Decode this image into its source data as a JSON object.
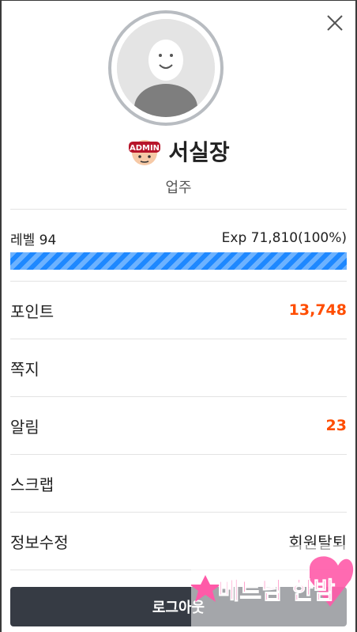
{
  "profile": {
    "nickname": "서실장",
    "role": "업주",
    "badge": "ADMIN"
  },
  "level": {
    "label": "레벨 94",
    "exp_text": "Exp 71,810(100%)",
    "progress_fraction": 1.0
  },
  "menu": {
    "points_label": "포인트",
    "points_value": "13,748",
    "messages_label": "쪽지",
    "alerts_label": "알림",
    "alerts_value": "23",
    "scrap_label": "스크랩",
    "edit_label": "정보수정",
    "withdraw_label": "회원탈퇴"
  },
  "logout_label": "로그아웃",
  "watermark": {
    "text": "베트남 한밤"
  },
  "colors": {
    "accent": "#ff4d00",
    "progress": "#1e88ff",
    "button": "#363b44"
  }
}
